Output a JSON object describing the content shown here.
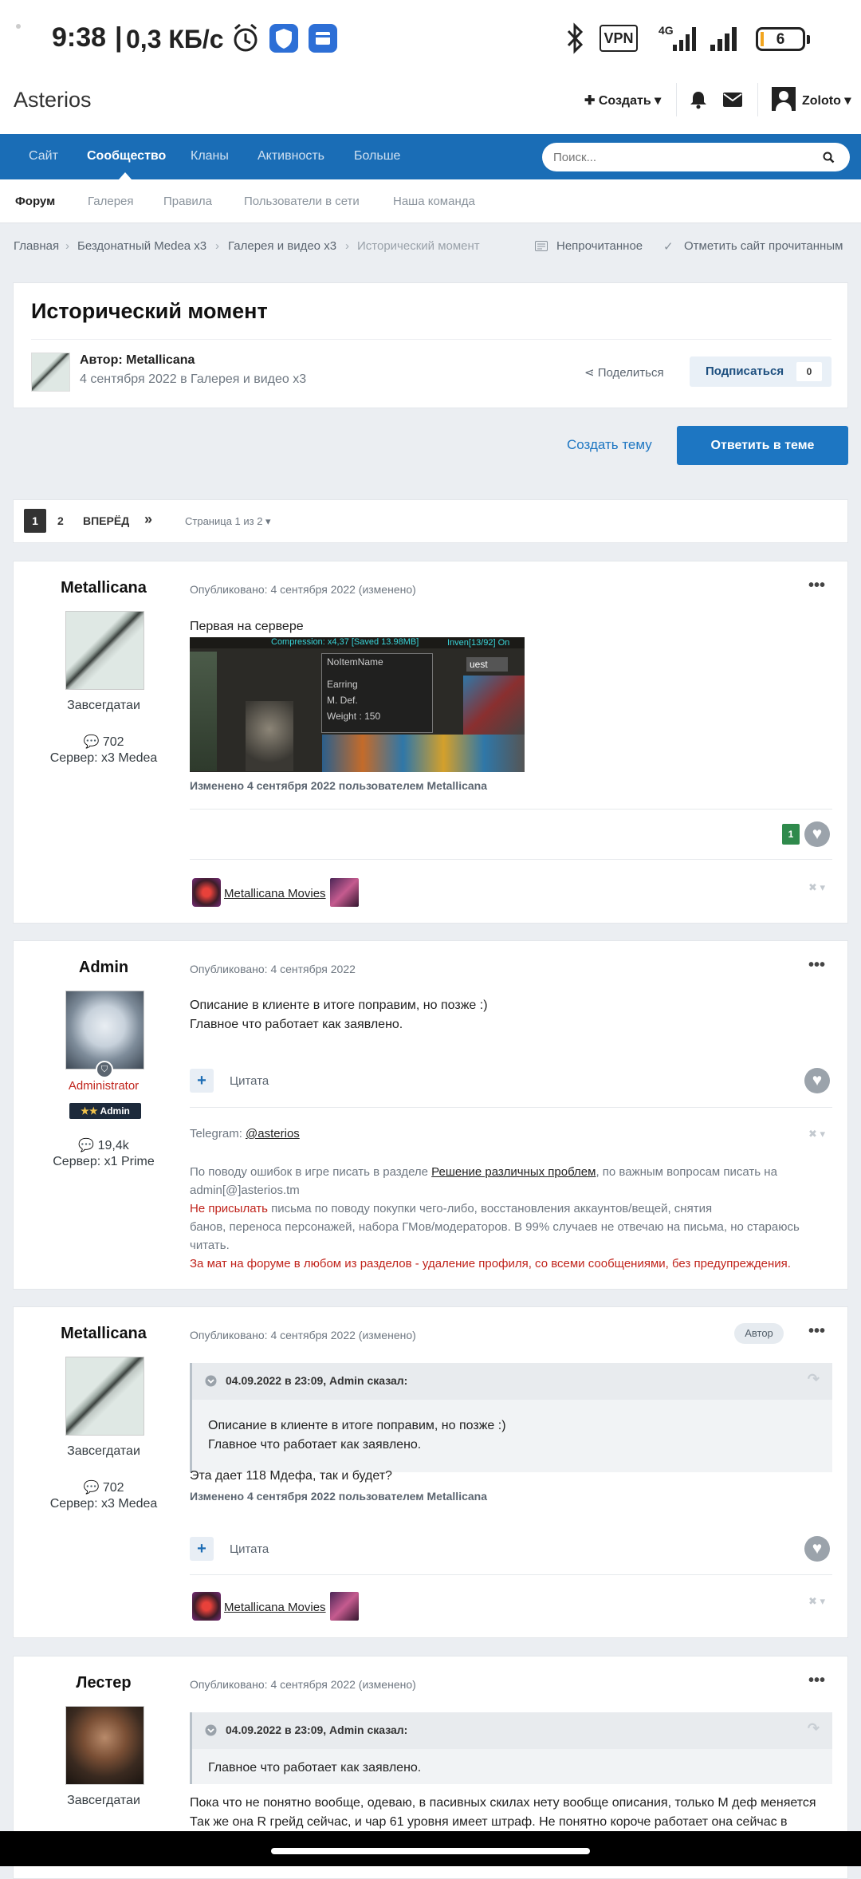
{
  "status_bar": {
    "time": "9:38",
    "speed": "0,3 КБ/с",
    "vpn": "VPN",
    "network": "4G",
    "battery": "6"
  },
  "header": {
    "brand": "Asterios",
    "create": "Создать",
    "user": "Zoloto"
  },
  "nav": {
    "items": [
      "Сайт",
      "Сообщество",
      "Кланы",
      "Активность",
      "Больше"
    ],
    "search_placeholder": "Поиск..."
  },
  "subnav": {
    "items": [
      "Форум",
      "Галерея",
      "Правила",
      "Пользователи в сети",
      "Наша команда"
    ]
  },
  "breadcrumb": {
    "items": [
      "Главная",
      "Бездонатный Medea x3",
      "Галерея и видео x3",
      "Исторический момент"
    ],
    "unread": "Непрочитанное",
    "mark_read": "Отметить сайт прочитанным"
  },
  "topic": {
    "title": "Исторический момент",
    "author_line": "Автор: Metallicana",
    "date_line": "4 сентября 2022 в Галерея и видео x3",
    "share": "Поделиться",
    "follow": "Подписаться",
    "follow_count": "0"
  },
  "actions": {
    "create_topic": "Создать тему",
    "reply": "Ответить в теме"
  },
  "pagination": {
    "current": "1",
    "page2": "2",
    "next": "ВПЕРЁД",
    "last": "»",
    "summary": "Страница 1 из 2"
  },
  "posts": [
    {
      "author": "Metallicana",
      "rank": "Завсегдатаи",
      "count": "702",
      "server": "Сервер: x3 Medea",
      "posted": "Опубликовано: 4 сентября 2022 (изменено)",
      "text": "Первая на сервере",
      "image_texts": {
        "top": "Compression: x4,37 [Saved 13.98MB]",
        "inv": "Inven[13/92] On",
        "name": "NoItemName",
        "l1": "Earring",
        "l2": "M. Def.",
        "l3": "Weight : 150",
        "quest": "uest"
      },
      "edited": "Изменено 4 сентября 2022 пользователем Metallicana",
      "likes": "1",
      "signature": "Metallicana Movies"
    },
    {
      "author": "Admin",
      "role": "Administrator",
      "badge": "Admin",
      "count": "19,4k",
      "server": "Сервер: x1 Prime",
      "posted": "Опубликовано: 4 сентября 2022",
      "line1": "Описание в клиенте в итоге поправим, но позже :)",
      "line2": "Главное что работает как заявлено.",
      "quote": "Цитата",
      "sig_telegram": "Telegram: ",
      "sig_handle": "@asterios",
      "sig_l1a": "По поводу ошибок в игре писать в разделе ",
      "sig_l1link": "Решение различных проблем",
      "sig_l1b": ", по важным вопросам писать на",
      "sig_l2": "admin[@]asterios.tm",
      "sig_l3red": "Не присылать",
      "sig_l3": " письма по поводу покупки чего-либо, восстановления аккаунтов/вещей, снятия",
      "sig_l4": "банов, переноса персонажей, набора ГМов/модераторов. В 99% случаев не отвечаю на письма, но стараюсь",
      "sig_l5": "читать.",
      "sig_l6": "За мат на форуме в любом из разделов - удаление профиля, со всеми сообщениями, без предупреждения."
    },
    {
      "author": "Metallicana",
      "rank": "Завсегдатаи",
      "count": "702",
      "server": "Сервер: x3 Medea",
      "posted": "Опубликовано: 4 сентября 2022 (изменено)",
      "author_badge": "Автор",
      "quote_header": "04.09.2022 в 23:09, Admin сказал:",
      "quote_l1": "Описание в клиенте в итоге поправим, но позже :)",
      "quote_l2": "Главное что работает как заявлено.",
      "text": "Эта дает 118 Мдефа, так и будет?",
      "edited": "Изменено 4 сентября 2022 пользователем Metallicana",
      "quote": "Цитата",
      "signature": "Metallicana Movies"
    },
    {
      "author": "Лестер",
      "rank": "Завсегдатаи",
      "posted": "Опубликовано: 4 сентября 2022 (изменено)",
      "quote_header": "04.09.2022 в 23:09, Admin сказал:",
      "quote_l1": "Главное что работает как заявлено.",
      "text_l1": "Пока что не понятно вообще, одеваю, в пасивных скилах нету вообще описания, только М деф меняется",
      "text_l2": "Так же она R грейд сейчас, и чар 61 уровня имеет штраф. Не понятно короче работает она сейчас в"
    }
  ],
  "colors": {
    "nav": "#1a6db6",
    "accent": "#1d76c2",
    "admin_red": "#c0241c",
    "like_green": "#2f8a4c"
  }
}
